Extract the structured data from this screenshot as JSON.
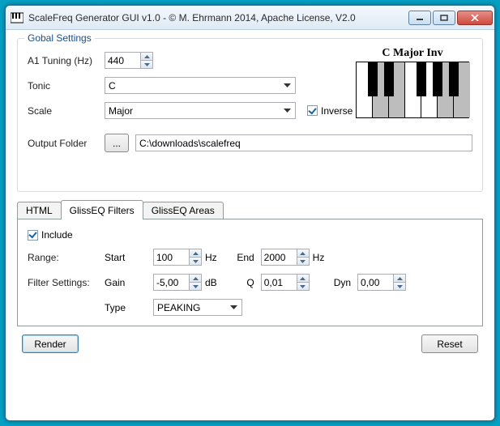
{
  "window": {
    "title": "ScaleFreq Generator GUI v1.0 - © M. Ehrmann 2014, Apache License, V2.0"
  },
  "global": {
    "legend": "Gobal Settings",
    "a1_label": "A1 Tuning (Hz)",
    "a1_value": "440",
    "tonic_label": "Tonic",
    "tonic_value": "C",
    "scale_label": "Scale",
    "scale_value": "Major",
    "inverse_label": "Inverse",
    "output_label": "Output Folder",
    "output_value": "C:\\downloads\\scalefreq",
    "browse_label": "...",
    "piano_title": "C Major Inv"
  },
  "tabs": {
    "html": "HTML",
    "filters": "GlissEQ Filters",
    "areas": "GlissEQ Areas"
  },
  "filters": {
    "include_label": "Include",
    "range_label": "Range:",
    "start_label": "Start",
    "start_value": "100",
    "hz": "Hz",
    "end_label": "End",
    "end_value": "2000",
    "settings_label": "Filter Settings:",
    "gain_label": "Gain",
    "gain_value": "-5,00",
    "db": "dB",
    "q_label": "Q",
    "q_value": "0,01",
    "dyn_label": "Dyn",
    "dyn_value": "0,00",
    "type_label": "Type",
    "type_value": "PEAKING"
  },
  "buttons": {
    "render": "Render",
    "reset": "Reset"
  }
}
